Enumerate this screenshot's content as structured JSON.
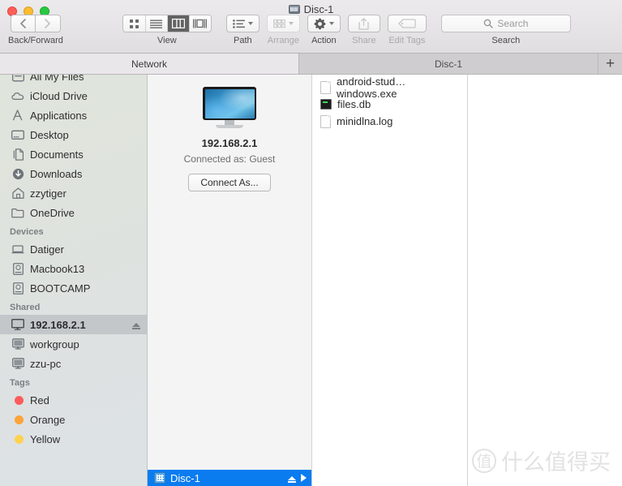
{
  "window": {
    "title": "Disc-1",
    "title_icon": "disk-icon",
    "controls": [
      "close-button",
      "minimize-button",
      "zoom-button"
    ]
  },
  "toolbar": {
    "nav": {
      "caption": "Back/Forward",
      "back_icon": "chevron-left-icon",
      "forward_icon": "chevron-right-icon"
    },
    "view": {
      "caption": "View",
      "options": [
        {
          "name": "icon-view",
          "icon": "grid-icon",
          "active": false
        },
        {
          "name": "list-view",
          "icon": "list-icon",
          "active": false
        },
        {
          "name": "column-view",
          "icon": "columns-icon",
          "active": true
        },
        {
          "name": "coverflow-view",
          "icon": "coverflow-icon",
          "active": false
        }
      ]
    },
    "path": {
      "caption": "Path",
      "icon": "path-list-icon",
      "enabled": true
    },
    "arrange": {
      "caption": "Arrange",
      "icon": "arrange-grid-icon",
      "enabled": false
    },
    "action": {
      "caption": "Action",
      "icon": "gear-icon",
      "enabled": true
    },
    "share": {
      "caption": "Share",
      "icon": "share-icon",
      "enabled": false
    },
    "edit_tags": {
      "caption": "Edit Tags",
      "icon": "tag-icon",
      "enabled": false
    },
    "search": {
      "caption": "Search",
      "placeholder": "Search",
      "value": "",
      "icon": "search-icon"
    }
  },
  "tabs": {
    "items": [
      {
        "label": "Network",
        "active": true
      },
      {
        "label": "Disc-1",
        "active": false
      }
    ],
    "new_tab_label": "+"
  },
  "sidebar": {
    "sections": [
      {
        "header": "",
        "items": [
          {
            "label": "All My Files",
            "icon": "all-my-files-icon",
            "selected": false,
            "eject": false
          },
          {
            "label": "iCloud Drive",
            "icon": "icloud-icon",
            "selected": false,
            "eject": false
          },
          {
            "label": "Applications",
            "icon": "applications-icon",
            "selected": false,
            "eject": false
          },
          {
            "label": "Desktop",
            "icon": "desktop-icon",
            "selected": false,
            "eject": false
          },
          {
            "label": "Documents",
            "icon": "documents-icon",
            "selected": false,
            "eject": false
          },
          {
            "label": "Downloads",
            "icon": "downloads-icon",
            "selected": false,
            "eject": false
          },
          {
            "label": "zzytiger",
            "icon": "home-icon",
            "selected": false,
            "eject": false
          },
          {
            "label": "OneDrive",
            "icon": "folder-icon",
            "selected": false,
            "eject": false
          }
        ]
      },
      {
        "header": "Devices",
        "items": [
          {
            "label": "Datiger",
            "icon": "laptop-icon",
            "selected": false,
            "eject": false
          },
          {
            "label": "Macbook13",
            "icon": "hard-drive-icon",
            "selected": false,
            "eject": false
          },
          {
            "label": "BOOTCAMP",
            "icon": "hard-drive-icon",
            "selected": false,
            "eject": false
          }
        ]
      },
      {
        "header": "Shared",
        "items": [
          {
            "label": "192.168.2.1",
            "icon": "display-icon",
            "selected": true,
            "eject": true
          },
          {
            "label": "workgroup",
            "icon": "display-icon",
            "selected": false,
            "eject": false
          },
          {
            "label": "zzu-pc",
            "icon": "display-icon",
            "selected": false,
            "eject": false
          }
        ]
      },
      {
        "header": "Tags",
        "items": [
          {
            "label": "Red",
            "icon": "tag-dot",
            "color": "#fd5c5c",
            "selected": false,
            "eject": false
          },
          {
            "label": "Orange",
            "icon": "tag-dot",
            "color": "#fca43a",
            "selected": false,
            "eject": false
          },
          {
            "label": "Yellow",
            "icon": "tag-dot",
            "color": "#fdd24f",
            "selected": false,
            "eject": false
          }
        ]
      }
    ]
  },
  "server_column": {
    "icon": "computer-display-icon",
    "name": "192.168.2.1",
    "status": "Connected as: Guest",
    "connect_button": "Connect As...",
    "shares": [
      {
        "label": "Disc-1",
        "selected": true,
        "icon": "volume-icon",
        "eject_icon": "eject-icon",
        "disclosure_icon": "chevron-right-icon"
      }
    ]
  },
  "file_column": {
    "files": [
      {
        "name": "android-stud…windows.exe",
        "icon": "document-icon"
      },
      {
        "name": "files.db",
        "icon": "database-terminal-icon"
      },
      {
        "name": "minidlna.log",
        "icon": "document-icon"
      }
    ]
  },
  "watermark": {
    "badge": "值",
    "text": "什么值得买"
  },
  "colors": {
    "accent": "#0a7cf0",
    "selected_sidebar": "#c3c7ca",
    "sidebar_bg": "#dfe3dd"
  }
}
